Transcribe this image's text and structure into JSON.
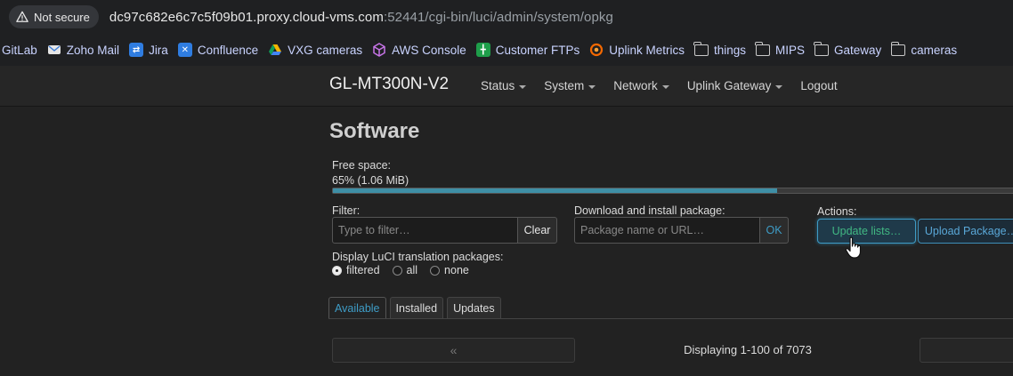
{
  "browser": {
    "security_label": "Not secure",
    "url_host": "dc97c682e6c7c5f09b01.proxy.cloud-vms.com",
    "url_rest": ":52441/cgi-bin/luci/admin/system/opkg"
  },
  "bookmarks": [
    {
      "label": "GitLab",
      "icon": "gitlab-icon"
    },
    {
      "label": "Zoho Mail",
      "icon": "zoho-mail-icon"
    },
    {
      "label": "Jira",
      "icon": "jira-icon"
    },
    {
      "label": "Confluence",
      "icon": "confluence-icon"
    },
    {
      "label": "VXG cameras",
      "icon": "google-drive-icon"
    },
    {
      "label": "AWS Console",
      "icon": "aws-cube-icon"
    },
    {
      "label": "Customer FTPs",
      "icon": "sheets-icon"
    },
    {
      "label": "Uplink Metrics",
      "icon": "grafana-icon"
    },
    {
      "label": "things",
      "icon": "folder-icon"
    },
    {
      "label": "MIPS",
      "icon": "folder-icon"
    },
    {
      "label": "Gateway",
      "icon": "folder-icon"
    },
    {
      "label": "cameras",
      "icon": "folder-icon"
    }
  ],
  "nav": {
    "brand": "GL-MT300N-V2",
    "items": [
      "Status",
      "System",
      "Network",
      "Uplink Gateway"
    ],
    "logout": "Logout"
  },
  "page": {
    "title": "Software",
    "free_space_label": "Free space:",
    "free_space_value": "65% (1.06 MiB)",
    "free_space_fraction": 0.65,
    "filter_label": "Filter:",
    "filter_placeholder": "Type to filter…",
    "clear_label": "Clear",
    "download_label": "Download and install package:",
    "download_placeholder": "Package name or URL…",
    "ok_label": "OK",
    "actions_label": "Actions:",
    "update_label": "Update lists…",
    "upload_label": "Upload Package…",
    "translation_label": "Display LuCI translation packages:",
    "translation_options": [
      "filtered",
      "all",
      "none"
    ],
    "translation_selected": "filtered",
    "tabs": [
      "Available",
      "Installed",
      "Updates"
    ],
    "active_tab": "Available",
    "pager_prev": "«",
    "pager_text": "Displaying 1-100 of 7073"
  },
  "colors": {
    "accent": "#3e9cc6",
    "update_text": "#41b883"
  }
}
